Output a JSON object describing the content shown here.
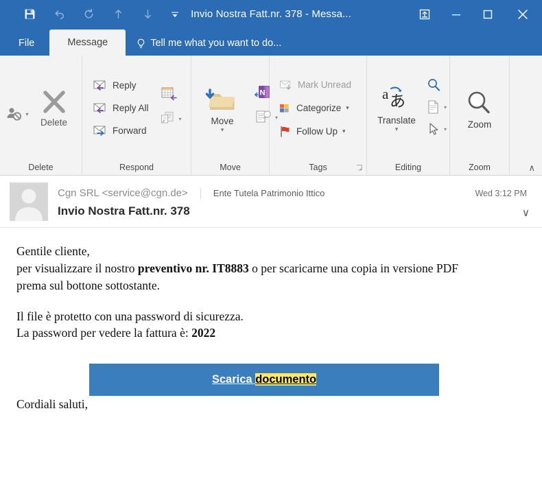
{
  "window": {
    "title": "Invio Nostra Fatt.nr. 378 - Messa...",
    "quick_access": [
      {
        "name": "save",
        "glyph": "💾",
        "enabled": true
      },
      {
        "name": "undo",
        "glyph": "↶",
        "enabled": false
      },
      {
        "name": "redo",
        "glyph": "↻",
        "enabled": false
      },
      {
        "name": "previous-item",
        "glyph": "↑",
        "enabled": false
      },
      {
        "name": "next-item",
        "glyph": "↓",
        "enabled": false
      },
      {
        "name": "customize-quick-access-toolbar",
        "glyph": "▾",
        "enabled": true
      }
    ],
    "controls": {
      "restore_ribbon": "⤒",
      "minimize": "─",
      "maximize": "□",
      "close": "✕"
    }
  },
  "tabs": {
    "file": "File",
    "message": "Message",
    "tell_me_placeholder": "Tell me what you want to do..."
  },
  "ribbon": {
    "groups": [
      {
        "label": "Delete",
        "items": [
          {
            "name": "ignore-button",
            "label": ""
          },
          {
            "name": "delete-button",
            "label": "Delete"
          }
        ]
      },
      {
        "label": "Respond",
        "items": [
          {
            "name": "reply-button",
            "label": "Reply"
          },
          {
            "name": "reply-all-button",
            "label": "Reply All"
          },
          {
            "name": "forward-button",
            "label": "Forward"
          },
          {
            "name": "meeting-button",
            "label": ""
          },
          {
            "name": "more-respond-button",
            "label": ""
          }
        ]
      },
      {
        "label": "Move",
        "items": [
          {
            "name": "move-button",
            "label": "Move"
          },
          {
            "name": "onenote-button",
            "label": ""
          },
          {
            "name": "actions-button",
            "label": ""
          }
        ]
      },
      {
        "label": "Tags",
        "items": [
          {
            "name": "mark-unread-button",
            "label": "Mark Unread"
          },
          {
            "name": "categorize-button",
            "label": "Categorize"
          },
          {
            "name": "follow-up-button",
            "label": "Follow Up"
          }
        ]
      },
      {
        "label": "Editing",
        "items": [
          {
            "name": "translate-button",
            "label": "Translate"
          },
          {
            "name": "find-button",
            "label": ""
          },
          {
            "name": "related-button",
            "label": ""
          },
          {
            "name": "select-button",
            "label": ""
          }
        ]
      },
      {
        "label": "Zoom",
        "items": [
          {
            "name": "zoom-button",
            "label": "Zoom"
          }
        ]
      }
    ],
    "labels": {
      "delete": "Delete",
      "respond": "Respond",
      "move": "Move",
      "tags": "Tags",
      "editing": "Editing",
      "zoom": "Zoom"
    },
    "buttons": {
      "delete": "Delete",
      "reply": "Reply",
      "reply_all": "Reply All",
      "forward": "Forward",
      "move": "Move",
      "mark_unread": "Mark Unread",
      "categorize": "Categorize",
      "follow_up": "Follow Up",
      "translate": "Translate",
      "zoom": "Zoom"
    },
    "collapse_caret": "∧"
  },
  "message": {
    "from": "Cgn SRL <service@cgn.de>",
    "organization": "Ente Tutela Patrimonio Ittico",
    "received": "Wed 3:12 PM",
    "subject": "Invio Nostra Fatt.nr. 378",
    "expand_caret": "∨"
  },
  "body": {
    "greeting": "Gentile cliente,",
    "line2_pre": "per visualizzare il nostro ",
    "line2_bold": "preventivo nr. IT8883",
    "line2_post": " o per scaricarne una copia in versione PDF",
    "line3": "prema sul bottone sottostante.",
    "line4": "Il file è protetto con una password di sicurezza.",
    "line5_pre": "La password per vedere la fattura è: ",
    "line5_bold": "2022",
    "cta_part1": "Scarica ",
    "cta_part2": "documento",
    "signoff": "Cordiali saluti,"
  },
  "colors": {
    "titlebar_blue": "#2b6cb4",
    "ribbon_bg": "#f3f3f3",
    "cta_blue": "#3a7ebd",
    "highlight_yellow": "#ffe96b",
    "folder_tan": "#e3c68a",
    "flag_red": "#e03c27",
    "accent_purple": "#7a4b9e"
  }
}
